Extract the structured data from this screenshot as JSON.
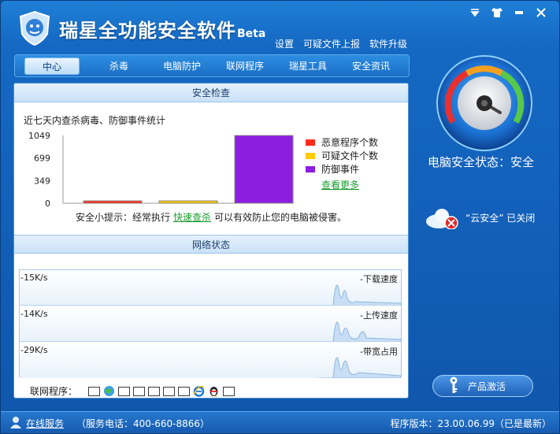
{
  "app": {
    "title": "瑞星全功能安全软件",
    "beta": "Beta",
    "top_links": [
      "设置",
      "可疑文件上报",
      "软件升级"
    ]
  },
  "tabs": [
    "中心",
    "杀毒",
    "电脑防护",
    "联网程序",
    "瑞星工具",
    "安全资讯"
  ],
  "security_check": {
    "heading": "安全检查",
    "caption": "近七天内查杀病毒、防御事件统计",
    "more_link": "查看更多",
    "tip_prefix": "安全小提示：经常执行",
    "tip_link": "快速查杀",
    "tip_suffix": "可以有效防止您的电脑被侵害。"
  },
  "chart_data": {
    "type": "bar",
    "title": "",
    "categories": [
      "恶意程序个数",
      "可疑文件个数",
      "防御事件"
    ],
    "values": [
      0,
      0,
      1049
    ],
    "ylim": [
      0,
      1049
    ],
    "yticks": [
      "1049",
      "699",
      "349",
      "0"
    ],
    "colors": [
      "#ff2a1a",
      "#ffcc00",
      "#8c1ee0"
    ],
    "legend_position": "right"
  },
  "network": {
    "heading": "网络状态",
    "rows": [
      {
        "value": "-15K/s",
        "label": "-下载速度"
      },
      {
        "value": "-14K/s",
        "label": "-上传速度"
      },
      {
        "value": "-29K/s",
        "label": "-带宽占用"
      }
    ],
    "apps_label": "联网程序："
  },
  "status": {
    "pc_status": "电脑安全状态：安全",
    "cloud_text": "“云安全” 已关闭",
    "activate_label": "产品激活"
  },
  "statusbar": {
    "online_service": "在线服务",
    "hotline": "（服务电话：400-660-8866）",
    "version": "程序版本：23.00.06.99（已是最新）"
  },
  "icons": {
    "logo": "lion-shield-icon",
    "gauge": "security-gauge-icon",
    "cloud": "cloud-off-icon",
    "key": "key-icon",
    "user": "user-icon"
  }
}
